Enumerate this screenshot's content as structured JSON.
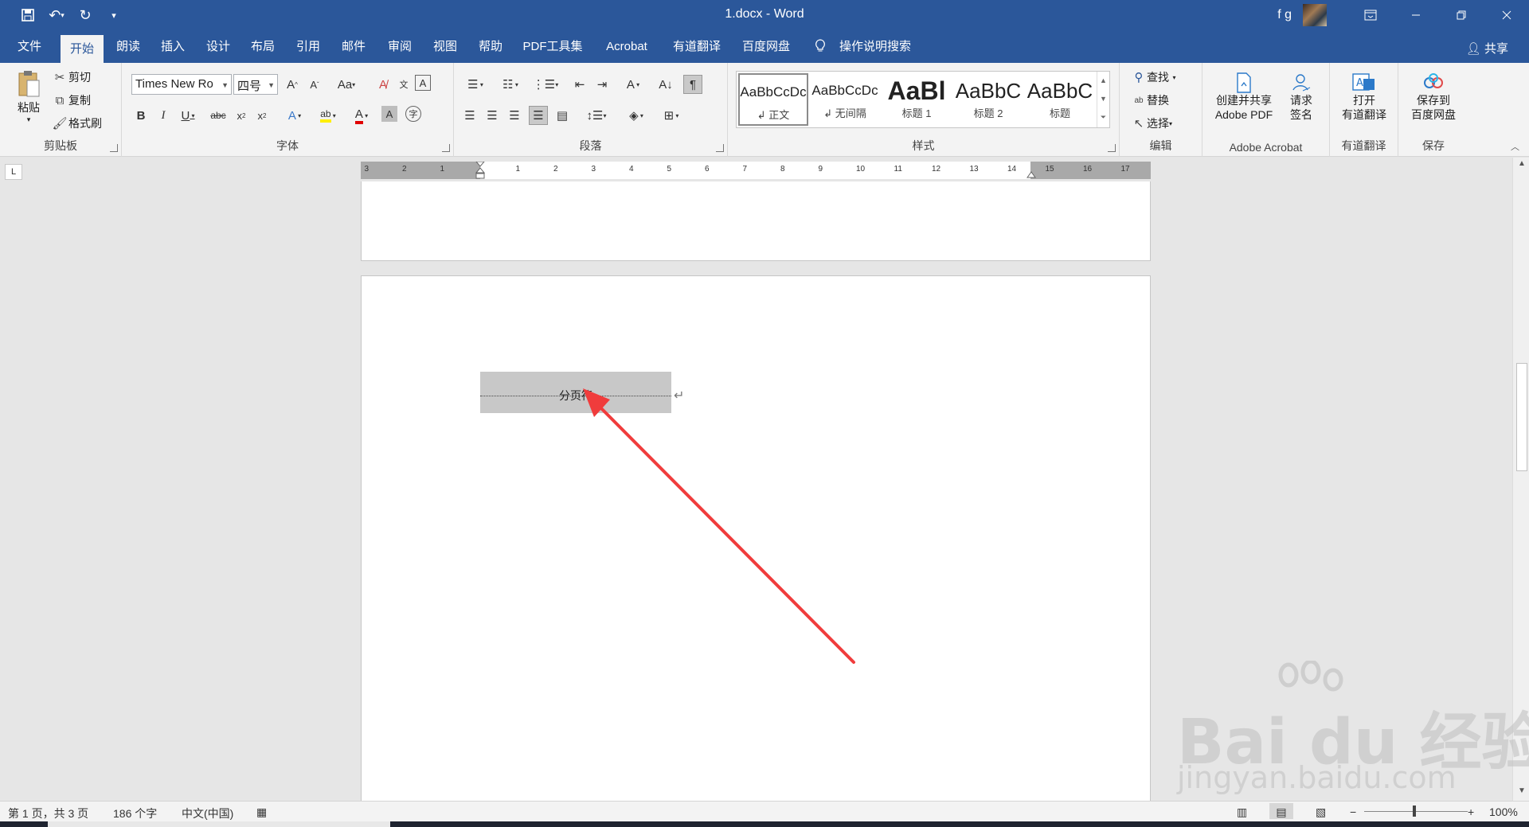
{
  "window": {
    "title": "1.docx  -  Word",
    "user_initials": "f g"
  },
  "tabs": [
    "文件",
    "开始",
    "朗读",
    "插入",
    "设计",
    "布局",
    "引用",
    "邮件",
    "审阅",
    "视图",
    "帮助",
    "PDF工具集",
    "Acrobat",
    "有道翻译",
    "百度网盘",
    "操作说明搜索"
  ],
  "share_label": "共享",
  "ribbon": {
    "clipboard": {
      "paste": "粘贴",
      "cut": "剪切",
      "copy": "复制",
      "format_painter": "格式刷",
      "label": "剪贴板"
    },
    "font": {
      "name": "Times New Ro",
      "size": "四号",
      "change_case": "Aa",
      "label": "字体"
    },
    "paragraph": {
      "label": "段落"
    },
    "styles": {
      "label": "样式",
      "items": [
        {
          "sample": "AaBbCcDc",
          "name": "↲ 正文"
        },
        {
          "sample": "AaBbCcDc",
          "name": "↲ 无间隔"
        },
        {
          "sample": "AaBl",
          "name": "标题 1"
        },
        {
          "sample": "AaBbC",
          "name": "标题 2"
        },
        {
          "sample": "AaBbC",
          "name": "标题"
        }
      ]
    },
    "editing": {
      "find": "查找",
      "replace": "替换",
      "select": "选择",
      "label": "编辑"
    },
    "acrobat": {
      "create_share_l1": "创建并共享",
      "create_share_l2": "Adobe PDF",
      "request_sign_l1": "请求",
      "request_sign_l2": "签名",
      "label": "Adobe Acrobat"
    },
    "youdao": {
      "open_l1": "打开",
      "open_l2": "有道翻译",
      "label": "有道翻译"
    },
    "save": {
      "save_to_l1": "保存到",
      "save_to_l2": "百度网盘",
      "label": "保存"
    }
  },
  "ruler": {
    "marks": [
      "3",
      "2",
      "1",
      "1",
      "2",
      "3",
      "4",
      "5",
      "6",
      "7",
      "8",
      "9",
      "10",
      "11",
      "12",
      "13",
      "14",
      "15",
      "16",
      "17"
    ]
  },
  "document": {
    "page_break_label": "分页符"
  },
  "status": {
    "page": "第 1 页，共 3 页",
    "words": "186 个字",
    "language": "中文(中国)",
    "zoom": "100%"
  },
  "watermark": {
    "main": "Bai du 经验",
    "sub": "jingyan.baidu.com"
  },
  "colors": {
    "brand": "#2b579a",
    "annotation_arrow": "#f03c3c"
  }
}
